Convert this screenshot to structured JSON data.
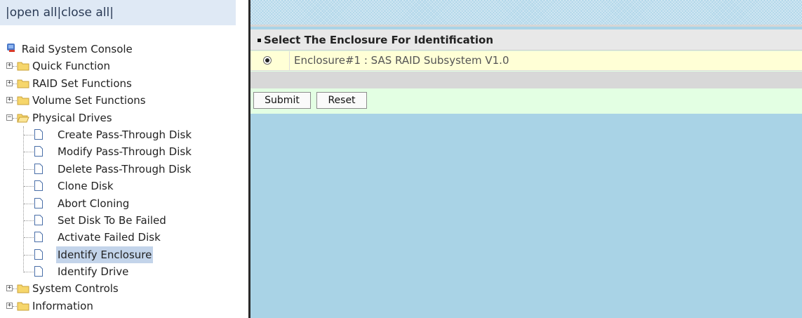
{
  "left": {
    "open_all": "open all",
    "close_all": "close all",
    "root_label": "Raid System Console",
    "folders": [
      {
        "label": "Quick Function",
        "expanded": false
      },
      {
        "label": "RAID Set Functions",
        "expanded": false
      },
      {
        "label": "Volume Set Functions",
        "expanded": false
      },
      {
        "label": "Physical Drives",
        "expanded": true
      },
      {
        "label": "System Controls",
        "expanded": false
      },
      {
        "label": "Information",
        "expanded": false
      }
    ],
    "physical_drives_items": [
      "Create Pass-Through Disk",
      "Modify Pass-Through Disk",
      "Delete Pass-Through Disk",
      "Clone Disk",
      "Abort Cloning",
      "Set Disk To Be Failed",
      "Activate Failed Disk",
      "Identify Enclosure",
      "Identify Drive"
    ],
    "selected_item": "Identify Enclosure"
  },
  "main": {
    "form_title": "Select The Enclosure For Identification",
    "enclosure_option": "Enclosure#1 : SAS RAID Subsystem V1.0",
    "enclosure_selected": true,
    "submit_label": "Submit",
    "reset_label": "Reset"
  },
  "colors": {
    "panel_background": "#a9d3e6",
    "form_background": "#e3ffe3",
    "option_row": "#ffffd6",
    "selected_highlight": "#c3d4ea"
  }
}
